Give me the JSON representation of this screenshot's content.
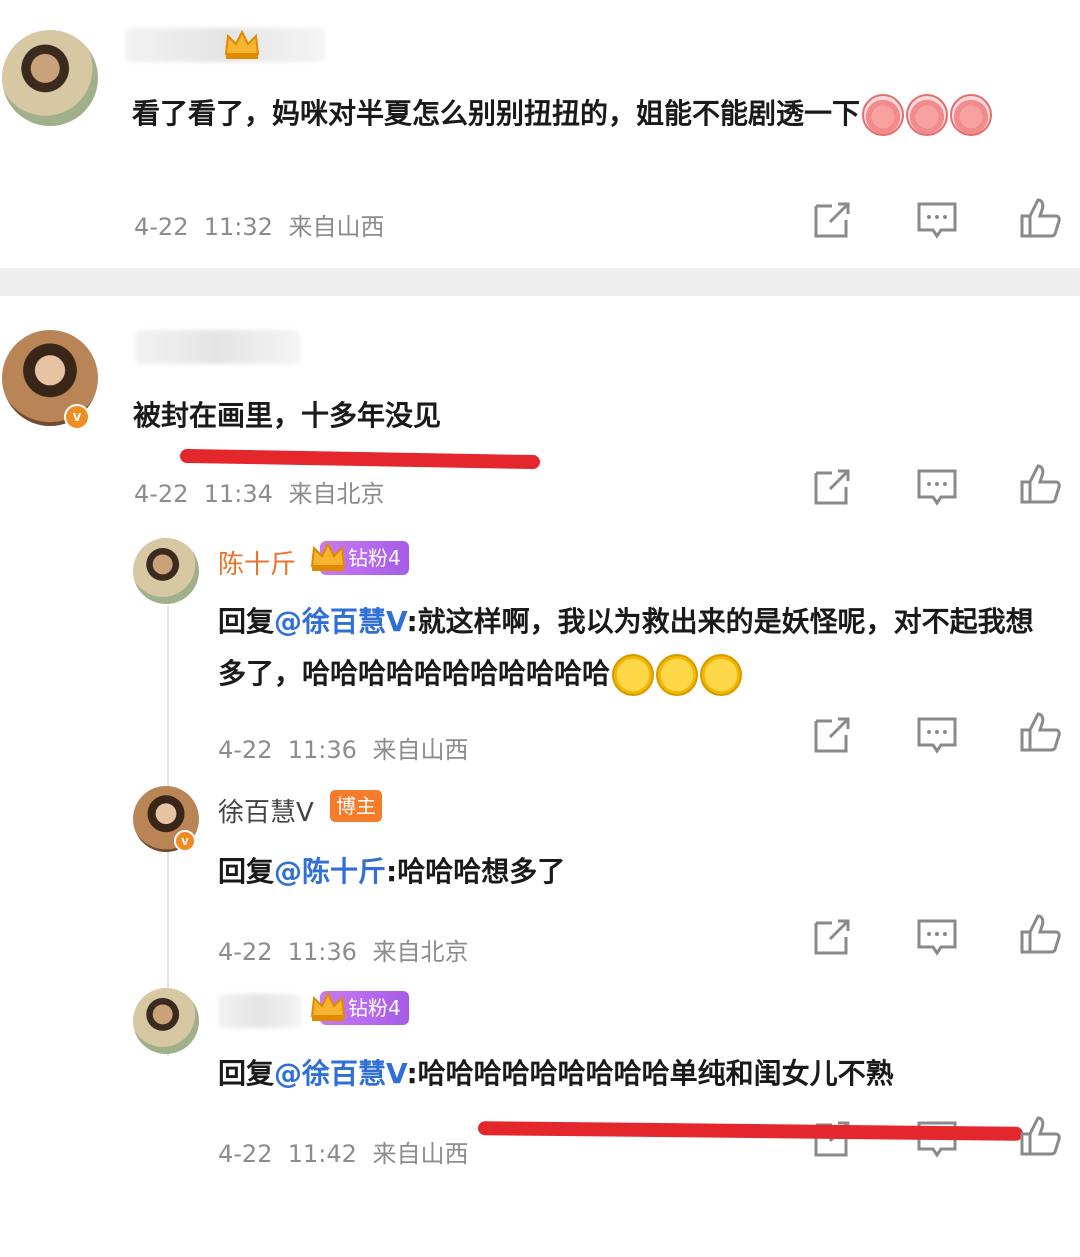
{
  "comments": [
    {
      "text": "看了看了，妈咪对半夏怎么别别扭扭的，姐能不能剧透一下",
      "time": "4-22  11:32",
      "location": "来自山西"
    },
    {
      "text": "被封在画里，十多年没见",
      "time": "4-22  11:34",
      "location": "来自北京"
    }
  ],
  "replies": [
    {
      "name": "陈十斤",
      "fan_badge": "钻粉4",
      "reply_prefix": "回复",
      "mention": "@徐百慧V",
      "text_line1": ":就这样啊，我以为救出来的是妖怪呢，对不起我想",
      "text_line2": "多了，哈哈哈哈哈哈哈哈哈哈哈",
      "time": "4-22  11:36",
      "location": "来自山西"
    },
    {
      "name": "徐百慧V",
      "blogger_badge": "博主",
      "reply_prefix": "回复",
      "mention": "@陈十斤",
      "text_line1": ":哈哈哈想多了",
      "time": "4-22  11:36",
      "location": "来自北京"
    },
    {
      "fan_badge": "钻粉4",
      "reply_prefix": "回复",
      "mention": "@徐百慧V",
      "text_line1": ":哈哈哈哈哈哈哈哈哈单纯和闺女儿不熟",
      "time": "4-22  11:42",
      "location": "来自山西"
    }
  ],
  "icons": [
    "share-icon",
    "comment-icon",
    "like-icon",
    "v-verified-icon",
    "crown-icon",
    "pig-emoji-icon",
    "laugh-cry-emoji-icon"
  ],
  "colors": {
    "mention": "#2f6fd6",
    "username_orange": "#e8742b",
    "fan_badge": "#b56ae9",
    "blogger_badge": "#f47c2a",
    "highlight": "#e3272d"
  }
}
